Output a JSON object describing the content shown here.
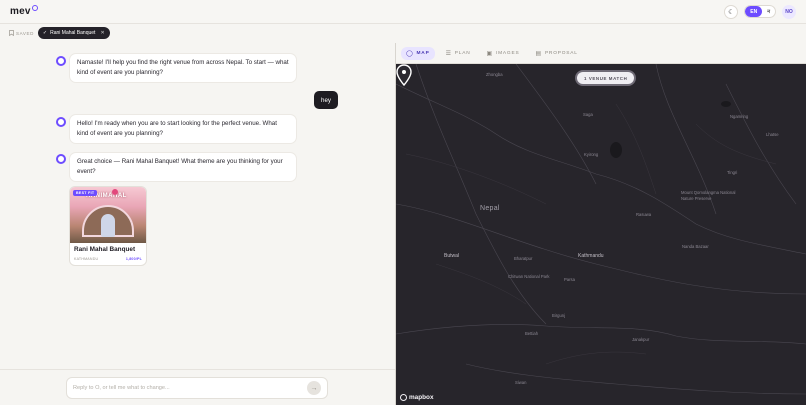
{
  "header": {
    "logo_text": "mev",
    "lang_options": [
      "EN",
      "न"
    ],
    "avatar_initials": "NO"
  },
  "saved": {
    "label": "SAVED",
    "chip_label": "Rani Mahal Banquet"
  },
  "messages": [
    {
      "role": "bot",
      "text": "Namaste! I'll help you find the right venue from across Nepal. To start — what kind of event are you planning?"
    },
    {
      "role": "user",
      "text": "hey"
    },
    {
      "role": "bot",
      "text": "Hello! I'm ready when you are to start looking for the perfect venue. What kind of event are you planning?"
    },
    {
      "role": "bot",
      "text": "Great choice — Rani Mahal Banquet! What theme are you thinking for your event?"
    }
  ],
  "venue_card": {
    "badge": "BEST FIT",
    "sign_text": "RANIMAHAL",
    "name": "Rani Mahal Banquet",
    "location": "KATHMANDU",
    "price": "1,800/PL"
  },
  "composer": {
    "placeholder": "Reply to O, or tell me what to change..."
  },
  "tabs": [
    {
      "label": "MAP",
      "active": true
    },
    {
      "label": "PLAN",
      "active": false
    },
    {
      "label": "IMAGES",
      "active": false
    },
    {
      "label": "PROPOSAL",
      "active": false
    }
  ],
  "map": {
    "match_pill": "1 VENUE MATCH",
    "country_label": "Nepal",
    "city_label": "Kathmandu",
    "labels": [
      "Zhongba",
      "Saga",
      "Ngamring",
      "Lhatse",
      "Kyirong",
      "Tingri",
      "Mount Qomolangma National Nature Preserve",
      "Rasuwa",
      "Butwal",
      "Bharatpur",
      "Chitwan National Park",
      "Parsa",
      "Janakpur",
      "Birgunj",
      "Bettiah",
      "Siwan",
      "Nanda Bazaar"
    ],
    "attribution": "mapbox"
  },
  "colors": {
    "accent": "#6d4cff",
    "map_bg": "#27252b"
  }
}
